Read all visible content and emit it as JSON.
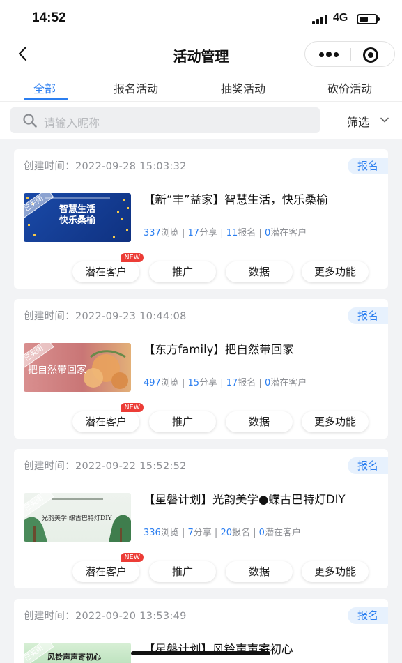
{
  "status_bar": {
    "time": "14:52",
    "network": "4G"
  },
  "nav": {
    "title": "活动管理"
  },
  "tabs": [
    {
      "label": "全部",
      "active": true
    },
    {
      "label": "报名活动",
      "active": false
    },
    {
      "label": "抽奖活动",
      "active": false
    },
    {
      "label": "砍价活动",
      "active": false
    }
  ],
  "search": {
    "placeholder": "请输入昵称",
    "filter_label": "筛选"
  },
  "colors": {
    "accent": "#2b7ef0",
    "new_badge": "#ec3c36"
  },
  "cards": [
    {
      "created": "创建时间：2022-09-28 15:03:32",
      "badge": "报名",
      "title": "【新“丰”益家】智慧生活，快乐桑榆",
      "thumb_text": "智慧生活\n快乐桑榆",
      "stats": {
        "views": "337",
        "views_label": "浏览",
        "shares": "17",
        "shares_label": "分享",
        "signups": "11",
        "signups_label": "报名",
        "leads": "0",
        "leads_label": "潜在客户"
      }
    },
    {
      "created": "创建时间：2022-09-23 10:44:08",
      "badge": "报名",
      "title": "【东方family】把自然带回家",
      "thumb_text": "把自然带回家",
      "stats": {
        "views": "497",
        "views_label": "浏览",
        "shares": "15",
        "shares_label": "分享",
        "signups": "17",
        "signups_label": "报名",
        "leads": "0",
        "leads_label": "潜在客户"
      }
    },
    {
      "created": "创建时间：2022-09-22 15:52:52",
      "badge": "报名",
      "title": "【星磐计划】光韵美学●蝶古巴特灯DIY",
      "thumb_text": "光韵美学·蝶古巴特灯DIY",
      "stats": {
        "views": "336",
        "views_label": "浏览",
        "shares": "7",
        "shares_label": "分享",
        "signups": "20",
        "signups_label": "报名",
        "leads": "0",
        "leads_label": "潜在客户"
      }
    },
    {
      "created": "创建时间：2022-09-20 13:53:49",
      "badge": "报名",
      "title": "【星磐计划】风铃声声寄初心",
      "thumb_text": "风铃声声寄初心"
    }
  ],
  "actions": {
    "leads": "潜在客户",
    "promote": "推广",
    "data": "数据",
    "more": "更多功能",
    "new_tag": "NEW"
  },
  "thumb_closed_tag": "已关闭"
}
